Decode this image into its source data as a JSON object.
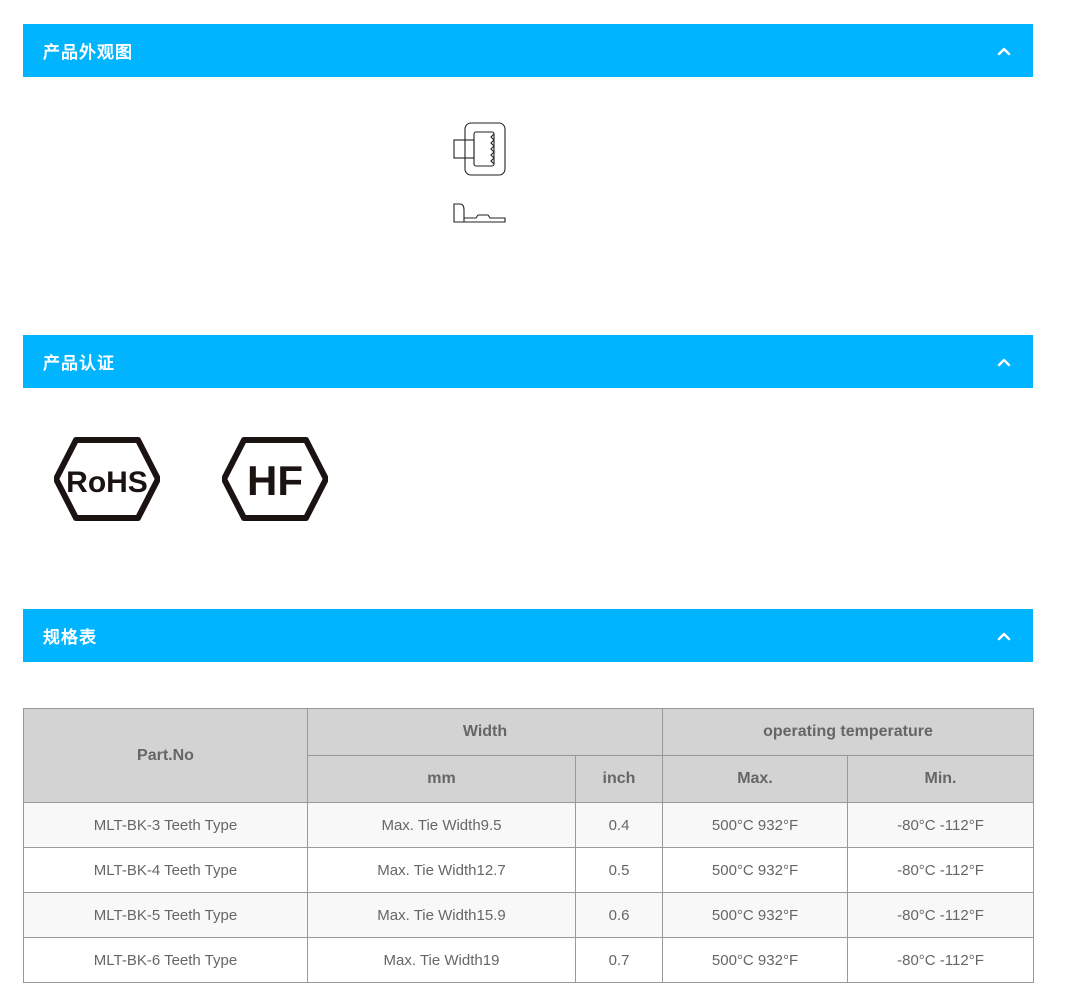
{
  "sections": [
    {
      "title": "产品外观图",
      "icon": "chevron-up-icon"
    },
    {
      "title": "产品认证",
      "icon": "chevron-up-icon"
    },
    {
      "title": "规格表",
      "icon": "chevron-up-icon"
    }
  ],
  "certifications": [
    "RoHS",
    "HF"
  ],
  "spec_table": {
    "headers": {
      "part_no": "Part.No",
      "width": "Width",
      "width_mm": "mm",
      "width_inch": "inch",
      "temp": "operating temperature",
      "temp_max": "Max.",
      "temp_min": "Min."
    },
    "rows": [
      {
        "part": "MLT-BK-3 Teeth Type",
        "mm": "Max. Tie Width9.5",
        "inch": "0.4",
        "max": "500°C 932°F",
        "min": "-80°C -112°F"
      },
      {
        "part": "MLT-BK-4 Teeth Type",
        "mm": "Max. Tie Width12.7",
        "inch": "0.5",
        "max": "500°C 932°F",
        "min": "-80°C -112°F"
      },
      {
        "part": "MLT-BK-5 Teeth Type",
        "mm": "Max. Tie Width15.9",
        "inch": "0.6",
        "max": "500°C 932°F",
        "min": "-80°C -112°F"
      },
      {
        "part": "MLT-BK-6 Teeth Type",
        "mm": "Max. Tie Width19",
        "inch": "0.7",
        "max": "500°C 932°F",
        "min": "-80°C -112°F"
      }
    ]
  },
  "colors": {
    "accent": "#00b4ff",
    "header_bg": "#d3d3d3",
    "text": "#666666",
    "border": "#999999"
  }
}
